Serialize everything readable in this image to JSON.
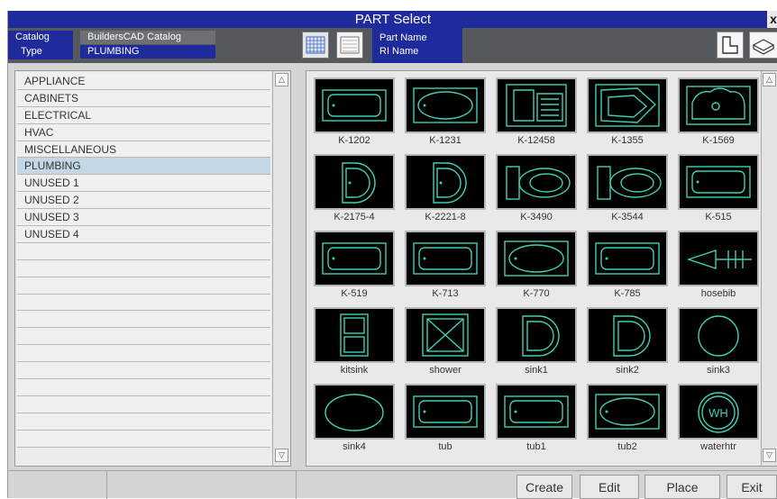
{
  "window": {
    "title": "PART Select",
    "close_glyph": "x"
  },
  "header": {
    "catalog_label": "Catalog",
    "catalog_value": "BuildersCAD Catalog",
    "type_label": "Type",
    "type_value": "PLUMBING",
    "sort_part_name": "Part Name",
    "sort_ri_name": "RI Name"
  },
  "categories": [
    {
      "label": "APPLIANCE",
      "selected": false
    },
    {
      "label": "CABINETS",
      "selected": false
    },
    {
      "label": "ELECTRICAL",
      "selected": false
    },
    {
      "label": "HVAC",
      "selected": false
    },
    {
      "label": "MISCELLANEOUS",
      "selected": false
    },
    {
      "label": "PLUMBING",
      "selected": true
    },
    {
      "label": "UNUSED 1",
      "selected": false
    },
    {
      "label": "UNUSED 2",
      "selected": false
    },
    {
      "label": "UNUSED 3",
      "selected": false
    },
    {
      "label": "UNUSED 4",
      "selected": false
    }
  ],
  "parts": [
    {
      "name": "K-1202",
      "icon": "tub-rect-icon"
    },
    {
      "name": "K-1231",
      "icon": "tub-oval-icon"
    },
    {
      "name": "K-12458",
      "icon": "shower-unit-icon"
    },
    {
      "name": "K-1355",
      "icon": "corner-tub-icon"
    },
    {
      "name": "K-1569",
      "icon": "whirlpool-tub-icon"
    },
    {
      "name": "K-2175-4",
      "icon": "d-sink-icon"
    },
    {
      "name": "K-2221-8",
      "icon": "d-sink-icon"
    },
    {
      "name": "K-3490",
      "icon": "toilet-icon"
    },
    {
      "name": "K-3544",
      "icon": "toilet-icon"
    },
    {
      "name": "K-515",
      "icon": "tub-rect-icon"
    },
    {
      "name": "K-519",
      "icon": "tub-rect-icon"
    },
    {
      "name": "K-713",
      "icon": "tub-rect-icon"
    },
    {
      "name": "K-770",
      "icon": "tub-oval-icon"
    },
    {
      "name": "K-785",
      "icon": "tub-rect-icon"
    },
    {
      "name": "hosebib",
      "icon": "hosebib-icon"
    },
    {
      "name": "kitsink",
      "icon": "kitchen-sink-icon"
    },
    {
      "name": "shower",
      "icon": "shower-icon"
    },
    {
      "name": "sink1",
      "icon": "sink-d-icon"
    },
    {
      "name": "sink2",
      "icon": "sink-d-icon"
    },
    {
      "name": "sink3",
      "icon": "sink-round-icon"
    },
    {
      "name": "sink4",
      "icon": "sink-oval-icon"
    },
    {
      "name": "tub",
      "icon": "tub-rect-icon"
    },
    {
      "name": "tub1",
      "icon": "tub-rect-icon"
    },
    {
      "name": "tub2",
      "icon": "tub-oval-icon"
    },
    {
      "name": "waterhtr",
      "icon": "water-heater-icon"
    }
  ],
  "water_heater_text": "WH",
  "buttons": {
    "create": "Create",
    "edit": "Edit",
    "place": "Place",
    "exit": "Exit"
  },
  "colors": {
    "titlebar": "#1f2a9c",
    "symbol_line": "#3fd0b4",
    "selected_row": "#c3d8e4"
  }
}
